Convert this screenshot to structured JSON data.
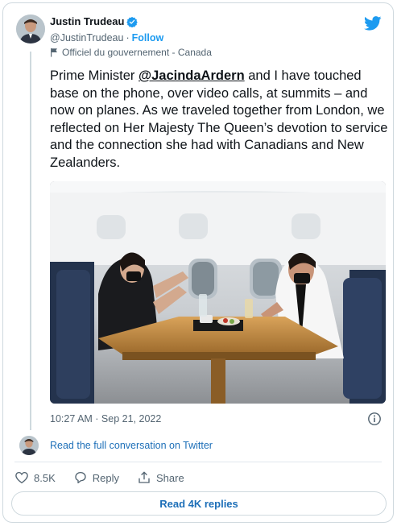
{
  "author": {
    "name": "Justin Trudeau",
    "handle": "@JustinTrudeau",
    "follow_label": "Follow",
    "government_label": "Officiel du gouvernement - Canada"
  },
  "tweet": {
    "text_before": "Prime Minister ",
    "mention": "@JacindaArdern",
    "text_after": " and I have touched base on the phone, over video calls, at summits – and now on planes. As we traveled together from London, we reflected on Her Majesty The Queen’s devotion to service and the connection she had with Canadians and New Zealanders.",
    "timestamp": "10:27 AM · Sep 21, 2022"
  },
  "thread": {
    "read_full_label": "Read the full conversation on Twitter"
  },
  "actions": {
    "likes": "8.5K",
    "reply_label": "Reply",
    "share_label": "Share"
  },
  "replies_button_label": "Read 4K replies",
  "colors": {
    "accent": "#1d9bf0",
    "link": "#1d6fb8",
    "muted": "#536471",
    "border": "#cfd9de"
  }
}
